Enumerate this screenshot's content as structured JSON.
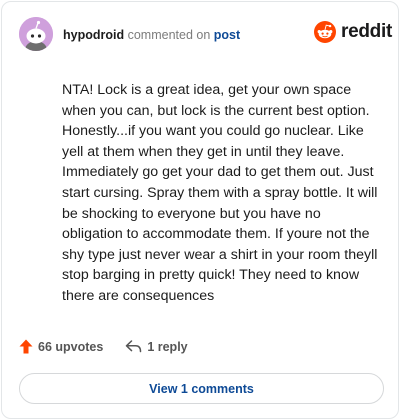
{
  "comment": {
    "username": "hypodroid",
    "action_text": "commented on",
    "post_link": "post",
    "body": "NTA! Lock is a great idea, get your own space when you can, but lock is the current best option. Honestly...if you want you could go nuclear. Like yell at them when they get in until they leave. Immediately go get your dad to get them out. Just start cursing. Spray them with a spray bottle. It will be shocking to everyone but you have no obligation to accommodate them. If youre not the shy type just never wear a shirt in your room theyll stop barging in pretty quick! They need to know there are consequences"
  },
  "brand": {
    "wordmark": "reddit",
    "icon": "reddit-snoo-logo",
    "color": "#ff4500"
  },
  "footer": {
    "upvotes": "66 upvotes",
    "upvote_icon": "upvote-arrow-icon",
    "upvote_color": "#ff4500",
    "replies": "1 reply",
    "reply_icon": "reply-arrow-icon"
  },
  "view_button": {
    "label": "View 1 comments"
  },
  "colors": {
    "link": "#0e4a96",
    "avatar_bg": "#cfa0dc",
    "border": "#e3e6e8"
  }
}
